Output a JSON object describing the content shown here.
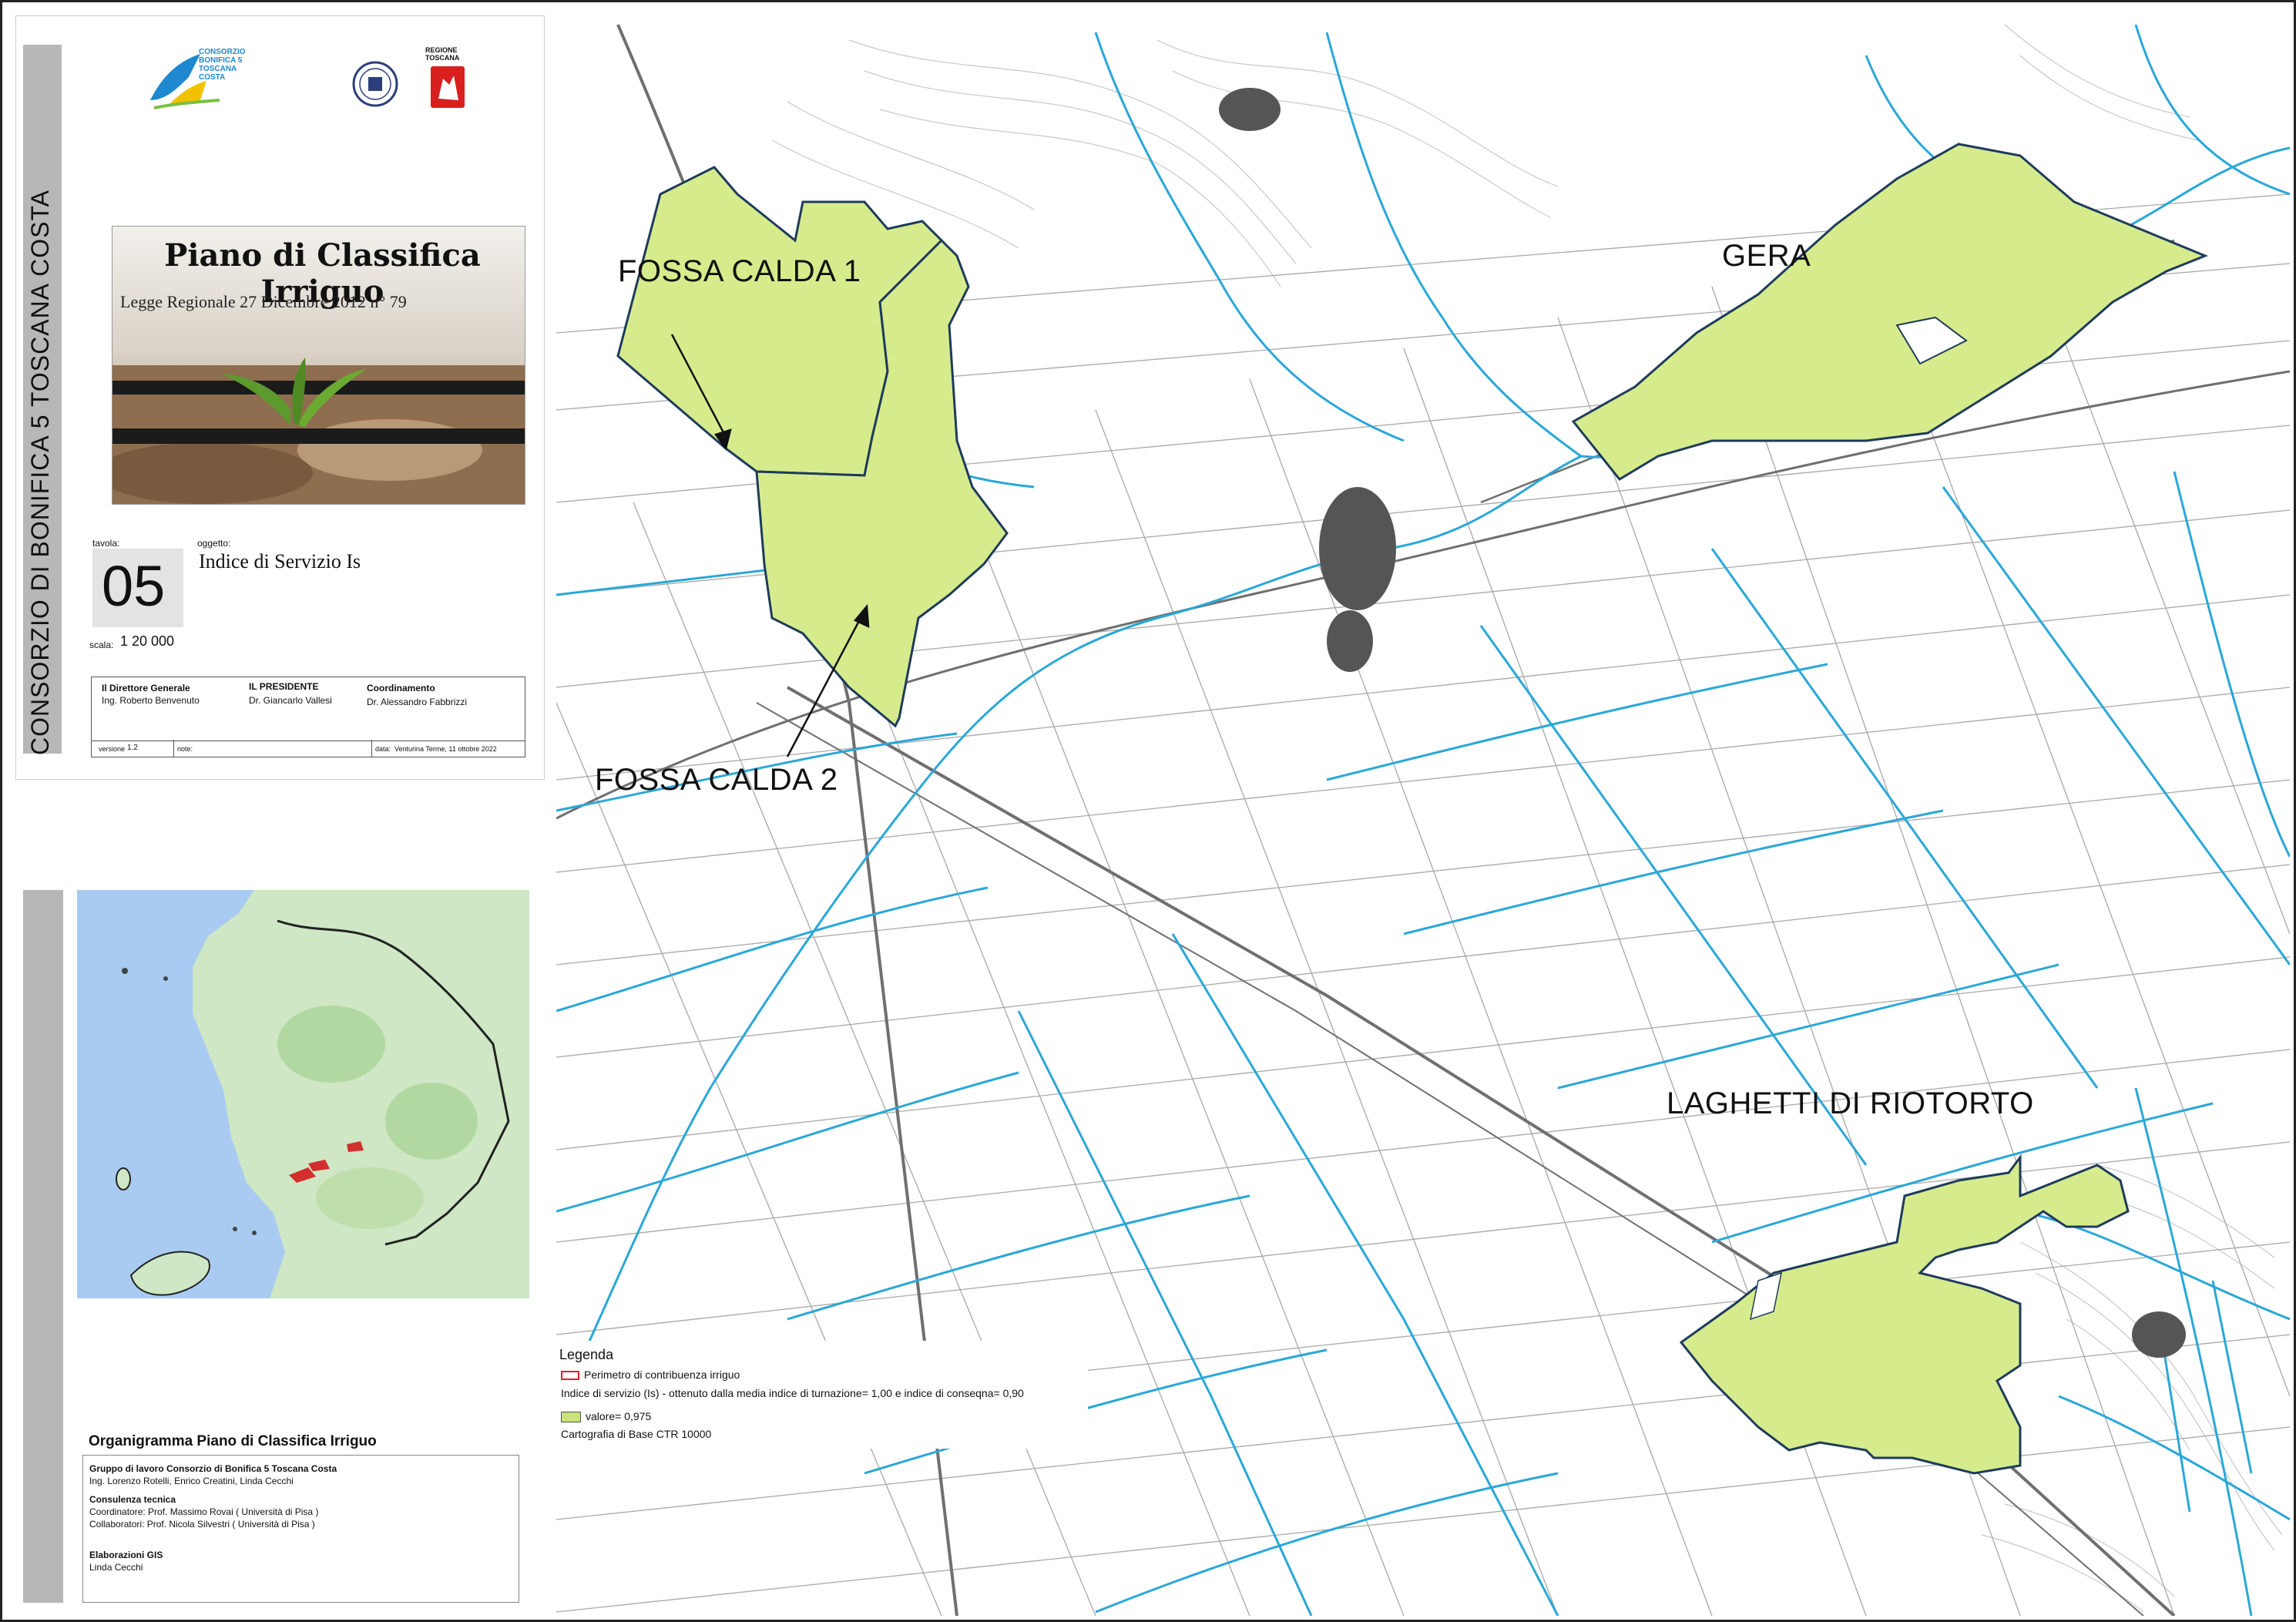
{
  "sheet": {
    "vertical_title": "CONSORZIO DI BONIFICA 5 TOSCANA COSTA",
    "logos": {
      "consorzio": "CONSORZIO BONIFICA 5 TOSCANA COSTA",
      "regione": "REGIONE TOSCANA"
    },
    "cover": {
      "title": "Piano di Classifica Irriguo",
      "subtitle": "Legge Regionale 27 Dicembre 2012 n° 79"
    },
    "tavola_label": "tavola:",
    "tavola_number": "05",
    "oggetto_label": "oggetto:",
    "oggetto_value": "Indice di Servizio Is",
    "scala_label": "scala:",
    "scala_value": "1 20 000",
    "signatures": [
      {
        "role": "Il Direttore Generale",
        "name": "Ing. Roberto Benvenuto"
      },
      {
        "role": "IL PRESIDENTE",
        "name": "Dr. Giancarlo Vallesi"
      },
      {
        "role": "Coordinamento",
        "name": "Dr. Alessandro Fabbrizzi"
      }
    ],
    "versione_label": "versione",
    "versione_value": "1.2",
    "note_label": "note:",
    "data_label": "data:",
    "data_value": "Venturina Terme, 11 ottobre 2022"
  },
  "map": {
    "areas": [
      {
        "label": "FOSSA CALDA 1"
      },
      {
        "label": "FOSSA CALDA 2"
      },
      {
        "label": "GERA"
      },
      {
        "label": "LAGHETTI DI RIOTORTO"
      }
    ],
    "colors": {
      "area_fill": "#d6ec8c",
      "area_stroke": "#1f3b5c",
      "river": "#2aa7d8",
      "background": "#ffffff",
      "lines": "#9a9a9a"
    }
  },
  "legend": {
    "title": "Legenda",
    "items": [
      {
        "swatch": "outline-red",
        "color": "#d22",
        "label": "Perimetro di contribuenza irriguo"
      },
      {
        "swatch": "none",
        "label": "Indice di servizio (Is) - ottenuto dalla media indice di turnazione= 1,00 e indice di conseqna= 0,90"
      },
      {
        "swatch": "fill",
        "color": "#c9e27a",
        "label": "valore= 0,975"
      },
      {
        "swatch": "none",
        "label": "Cartografia di Base CTR 10000"
      }
    ]
  },
  "organigramma": {
    "title": "Organigramma Piano di Classifica Irriguo",
    "lines": [
      {
        "text": "Gruppo di lavoro Consorzio di Bonifica 5 Toscana Costa",
        "bold": true
      },
      {
        "text": "Ing. Lorenzo Rotelli, Enrico Creatini, Linda Cecchi",
        "bold": false
      },
      {
        "text": "Consulenza tecnica",
        "bold": true
      },
      {
        "text": "Coordinatore: Prof. Massimo Rovai ( Università di Pisa )",
        "bold": false
      },
      {
        "text": "Collaboratori: Prof. Nicola Silvestri ( Università di Pisa )",
        "bold": false
      },
      {
        "text": "Elaborazioni GIS",
        "bold": true
      },
      {
        "text": "Linda Cecchi",
        "bold": false
      }
    ]
  }
}
